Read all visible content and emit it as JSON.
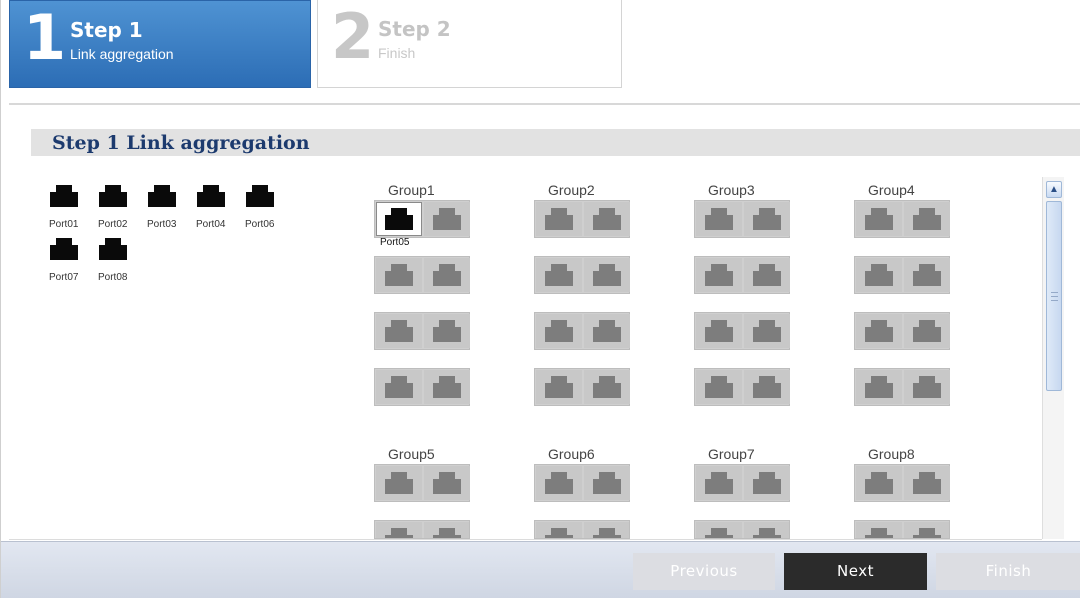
{
  "steps": [
    {
      "number": "1",
      "title": "Step 1",
      "subtitle": "Link aggregation",
      "active": true
    },
    {
      "number": "2",
      "title": "Step 2",
      "subtitle": "Finish",
      "active": false
    }
  ],
  "section_title": "Step 1 Link aggregation",
  "available_ports": [
    {
      "label": "Port01"
    },
    {
      "label": "Port02"
    },
    {
      "label": "Port03"
    },
    {
      "label": "Port04"
    },
    {
      "label": "Port06"
    },
    {
      "label": "Port07"
    },
    {
      "label": "Port08"
    }
  ],
  "groups": [
    {
      "name": "Group1",
      "assigned": [
        {
          "slot": 0,
          "label": "Port05"
        }
      ]
    },
    {
      "name": "Group2",
      "assigned": []
    },
    {
      "name": "Group3",
      "assigned": []
    },
    {
      "name": "Group4",
      "assigned": []
    },
    {
      "name": "Group5",
      "assigned": []
    },
    {
      "name": "Group6",
      "assigned": []
    },
    {
      "name": "Group7",
      "assigned": []
    },
    {
      "name": "Group8",
      "assigned": []
    }
  ],
  "buttons": {
    "previous": "Previous",
    "next": "Next",
    "finish": "Finish"
  },
  "icons": {
    "scroll_up": "chevron-up-icon",
    "port": "ethernet-port-icon"
  }
}
